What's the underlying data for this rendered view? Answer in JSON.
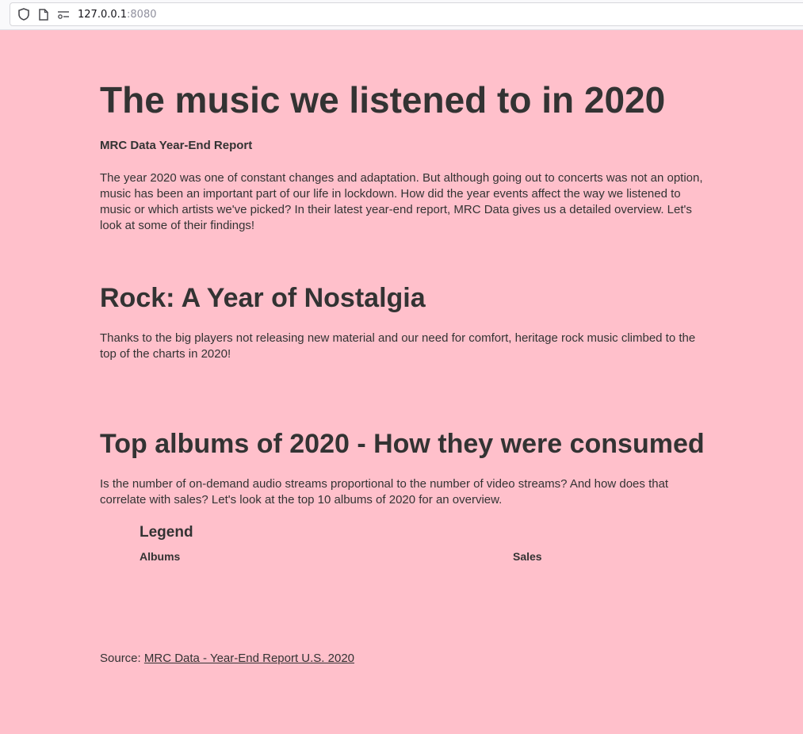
{
  "browser": {
    "url_host": "127.0.0.1",
    "url_port": ":8080",
    "icons": [
      "shield-icon",
      "page-icon",
      "connection-icon"
    ]
  },
  "page": {
    "background": "#ffc0cb",
    "text_color": "#333333",
    "title": "The music we listened to in 2020",
    "subtitle": "MRC Data Year-End Report",
    "intro": "The year 2020 was one of constant changes and adaptation. But although going out to concerts was not an option, music has been an important part of our life in lockdown. How did the year events affect the way we listened to music or which artists we've picked? In their latest year-end report, MRC Data gives us a detailed overview. Let's look at some of their findings!",
    "rock": {
      "title": "Rock: A Year of Nostalgia",
      "text": "Thanks to the big players not releasing new material and our need for comfort, heritage rock music climbed to the top of the charts in 2020!"
    },
    "albums": {
      "title": "Top albums of 2020 - How they were consumed",
      "text": "Is the number of on-demand audio streams proportional to the number of video streams? And how does that correlate with sales? Let's look at the top 10 albums of 2020 for an overview.",
      "legend": {
        "title": "Legend",
        "albums_label": "Albums",
        "sales_label": "Sales"
      }
    },
    "source": {
      "label": "Source: ",
      "link_text": "MRC Data - Year-End Report U.S. 2020"
    }
  }
}
